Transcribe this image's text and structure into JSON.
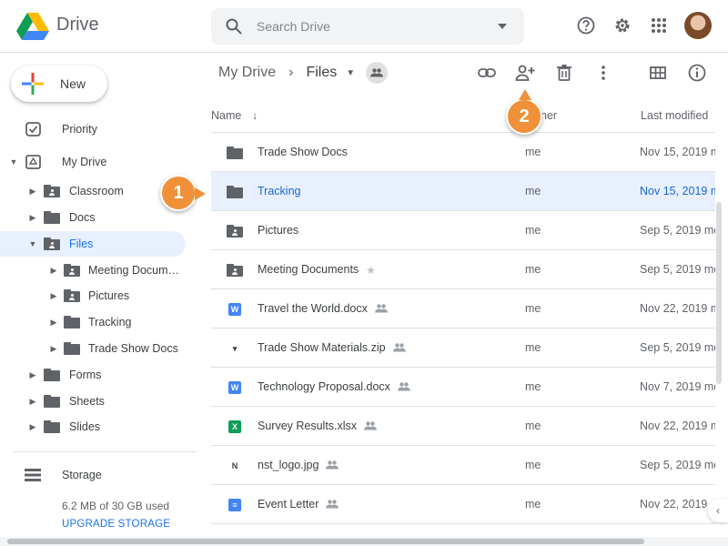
{
  "app": {
    "title": "Drive"
  },
  "search": {
    "placeholder": "Search Drive"
  },
  "header_icons": [
    "help-icon",
    "settings-icon",
    "apps-grid-icon"
  ],
  "sidebar": {
    "new_label": "New",
    "items": [
      {
        "label": "Priority",
        "icon": "checkbox-icon",
        "level": 0
      },
      {
        "label": "My Drive",
        "icon": "drive-icon",
        "level": 0,
        "expanded": true
      },
      {
        "label": "Classroom",
        "icon": "folder-shared-icon",
        "level": 1
      },
      {
        "label": "Docs",
        "icon": "folder-icon",
        "level": 1
      },
      {
        "label": "Files",
        "icon": "folder-shared-icon",
        "level": 1,
        "expanded": true,
        "selected": true
      },
      {
        "label": "Meeting Documen...",
        "icon": "folder-shared-icon",
        "level": 2
      },
      {
        "label": "Pictures",
        "icon": "folder-shared-icon",
        "level": 2
      },
      {
        "label": "Tracking",
        "icon": "folder-icon",
        "level": 2
      },
      {
        "label": "Trade Show Docs",
        "icon": "folder-icon",
        "level": 2
      },
      {
        "label": "Forms",
        "icon": "folder-icon",
        "level": 1
      },
      {
        "label": "Sheets",
        "icon": "folder-icon",
        "level": 1
      },
      {
        "label": "Slides",
        "icon": "folder-icon",
        "level": 1
      }
    ],
    "storage_label": "Storage",
    "storage_used": "6.2 MB of 30 GB used",
    "upgrade_label": "UPGRADE STORAGE"
  },
  "breadcrumb": {
    "root": "My Drive",
    "current": "Files"
  },
  "toolbar_icons": [
    "link-icon",
    "share-add-person-icon",
    "trash-icon",
    "more-vert-icon",
    "grid-view-icon",
    "info-icon"
  ],
  "table": {
    "columns": {
      "name": "Name",
      "owner": "ner",
      "modified": "Last modified"
    },
    "rows": [
      {
        "name": "Trade Show Docs",
        "owner": "me",
        "modified": "Nov 15, 2019 m",
        "type": "folder"
      },
      {
        "name": "Tracking",
        "owner": "me",
        "modified": "Nov 15, 2019 m",
        "type": "folder",
        "selected": true
      },
      {
        "name": "Pictures",
        "owner": "me",
        "modified": "Sep 5, 2019 me",
        "type": "folder-shared"
      },
      {
        "name": "Meeting Documents",
        "owner": "me",
        "modified": "Sep 5, 2019 me",
        "type": "folder-shared",
        "extra": "star"
      },
      {
        "name": "Travel the World.docx",
        "owner": "me",
        "modified": "Nov 22, 2019 me",
        "type": "word",
        "extra": "shared"
      },
      {
        "name": "Trade Show Materials.zip",
        "owner": "me",
        "modified": "Sep 5, 2019 me",
        "type": "zip",
        "extra": "shared"
      },
      {
        "name": "Technology Proposal.docx",
        "owner": "me",
        "modified": "Nov 7, 2019 me",
        "type": "word",
        "extra": "shared"
      },
      {
        "name": "Survey Results.xlsx",
        "owner": "me",
        "modified": "Nov 22, 2019 me",
        "type": "excel",
        "extra": "shared"
      },
      {
        "name": "nst_logo.jpg",
        "owner": "me",
        "modified": "Sep 5, 2019 me",
        "type": "image",
        "extra": "shared"
      },
      {
        "name": "Event Letter",
        "owner": "me",
        "modified": "Nov 22, 2019 me",
        "type": "gdoc",
        "extra": "shared"
      }
    ]
  },
  "callouts": [
    "1",
    "2"
  ],
  "colors": {
    "accent": "#1a73e8",
    "selected_bg": "#e8f0fe",
    "callout": "#f0913a"
  }
}
